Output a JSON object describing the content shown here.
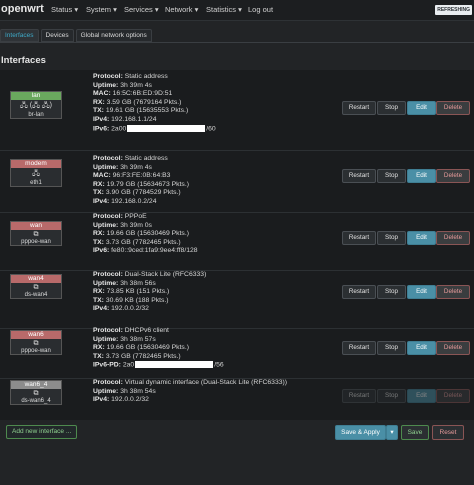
{
  "header": {
    "brand": "openwrt",
    "menu": [
      "Status ▾",
      "System ▾",
      "Services ▾",
      "Network ▾",
      "Statistics ▾",
      "Log out"
    ],
    "refresh": "REFRESHING"
  },
  "tabs": [
    {
      "label": "Interfaces",
      "active": true
    },
    {
      "label": "Devices",
      "active": false
    },
    {
      "label": "Global network options",
      "active": false
    }
  ],
  "section_title": "Interfaces",
  "interfaces": [
    {
      "name": "lan",
      "color": "#6aa85e",
      "icons": "🖧 (🖧 🖧)",
      "device": "br-lan",
      "lines": [
        [
          "Protocol:",
          "Static address"
        ],
        [
          "Uptime:",
          "3h 39m 4s"
        ],
        [
          "MAC:",
          "16:5C:6B:ED:9D:51"
        ],
        [
          "RX:",
          "3.59 GB (7679164 Pkts.)"
        ],
        [
          "TX:",
          "19.61 GB (15635553 Pkts.)"
        ],
        [
          "IPv4:",
          "192.168.1.1/24"
        ],
        [
          "IPv6:",
          "2a00",
          "/60"
        ]
      ],
      "buttons": {
        "restart": "Restart",
        "stop": "Stop",
        "edit": "Edit",
        "delete": "Delete"
      },
      "disabled": false
    },
    {
      "name": "modem",
      "color": "#b86a6a",
      "icons": "🖧",
      "device": "eth1",
      "lines": [
        [
          "Protocol:",
          "Static address"
        ],
        [
          "Uptime:",
          "3h 39m 4s"
        ],
        [
          "MAC:",
          "96:F3:FE:0B:64:B3"
        ],
        [
          "RX:",
          "19.79 GB (15634673 Pkts.)"
        ],
        [
          "TX:",
          "3.90 GB (7784529 Pkts.)"
        ],
        [
          "IPv4:",
          "192.168.0.2/24"
        ]
      ],
      "buttons": {
        "restart": "Restart",
        "stop": "Stop",
        "edit": "Edit",
        "delete": "Delete"
      },
      "disabled": false
    },
    {
      "name": "wan",
      "color": "#b86a6a",
      "icons": "⧉",
      "device": "pppoe-wan",
      "lines": [
        [
          "Protocol:",
          "PPPoE"
        ],
        [
          "Uptime:",
          "3h 39m 0s"
        ],
        [
          "RX:",
          "19.66 GB (15630469 Pkts.)"
        ],
        [
          "TX:",
          "3.73 GB (7782465 Pkts.)"
        ],
        [
          "IPv6:",
          "fe80::9ced:1fa9:9ee4:ff8/128"
        ]
      ],
      "buttons": {
        "restart": "Restart",
        "stop": "Stop",
        "edit": "Edit",
        "delete": "Delete"
      },
      "disabled": false
    },
    {
      "name": "wan4",
      "color": "#b86a6a",
      "icons": "⧉",
      "device": "ds-wan4",
      "lines": [
        [
          "Protocol:",
          "Dual-Stack Lite (RFC6333)"
        ],
        [
          "Uptime:",
          "3h 38m 56s"
        ],
        [
          "RX:",
          "73.85 KB (151 Pkts.)"
        ],
        [
          "TX:",
          "30.69 KB (188 Pkts.)"
        ],
        [
          "IPv4:",
          "192.0.0.2/32"
        ]
      ],
      "buttons": {
        "restart": "Restart",
        "stop": "Stop",
        "edit": "Edit",
        "delete": "Delete"
      },
      "disabled": false
    },
    {
      "name": "wan6",
      "color": "#b86a6a",
      "icons": "⧉",
      "device": "pppoe-wan",
      "lines": [
        [
          "Protocol:",
          "DHCPv6 client"
        ],
        [
          "Uptime:",
          "3h 38m 57s"
        ],
        [
          "RX:",
          "19.66 GB (15630469 Pkts.)"
        ],
        [
          "TX:",
          "3.73 GB (7782465 Pkts.)"
        ],
        [
          "IPv6-PD:",
          "2a0",
          "/56"
        ]
      ],
      "buttons": {
        "restart": "Restart",
        "stop": "Stop",
        "edit": "Edit",
        "delete": "Delete"
      },
      "disabled": false
    },
    {
      "name": "wan6_4",
      "color": "#8c8c8c",
      "icons": "⧉",
      "device": "ds-wan6_4",
      "lines": [
        [
          "Protocol:",
          "Virtual dynamic interface (Dual-Stack Lite (RFC6333))"
        ],
        [
          "Uptime:",
          "3h 38m 54s"
        ],
        [
          "IPv4:",
          "192.0.0.2/32"
        ]
      ],
      "buttons": {
        "restart": "Restart",
        "stop": "Stop",
        "edit": "Edit",
        "delete": "Delete"
      },
      "disabled": true
    }
  ],
  "add_button": "Add new interface ...",
  "footer": {
    "save_apply": "Save & Apply",
    "dropdown": "▾",
    "save": "Save",
    "reset": "Reset"
  }
}
